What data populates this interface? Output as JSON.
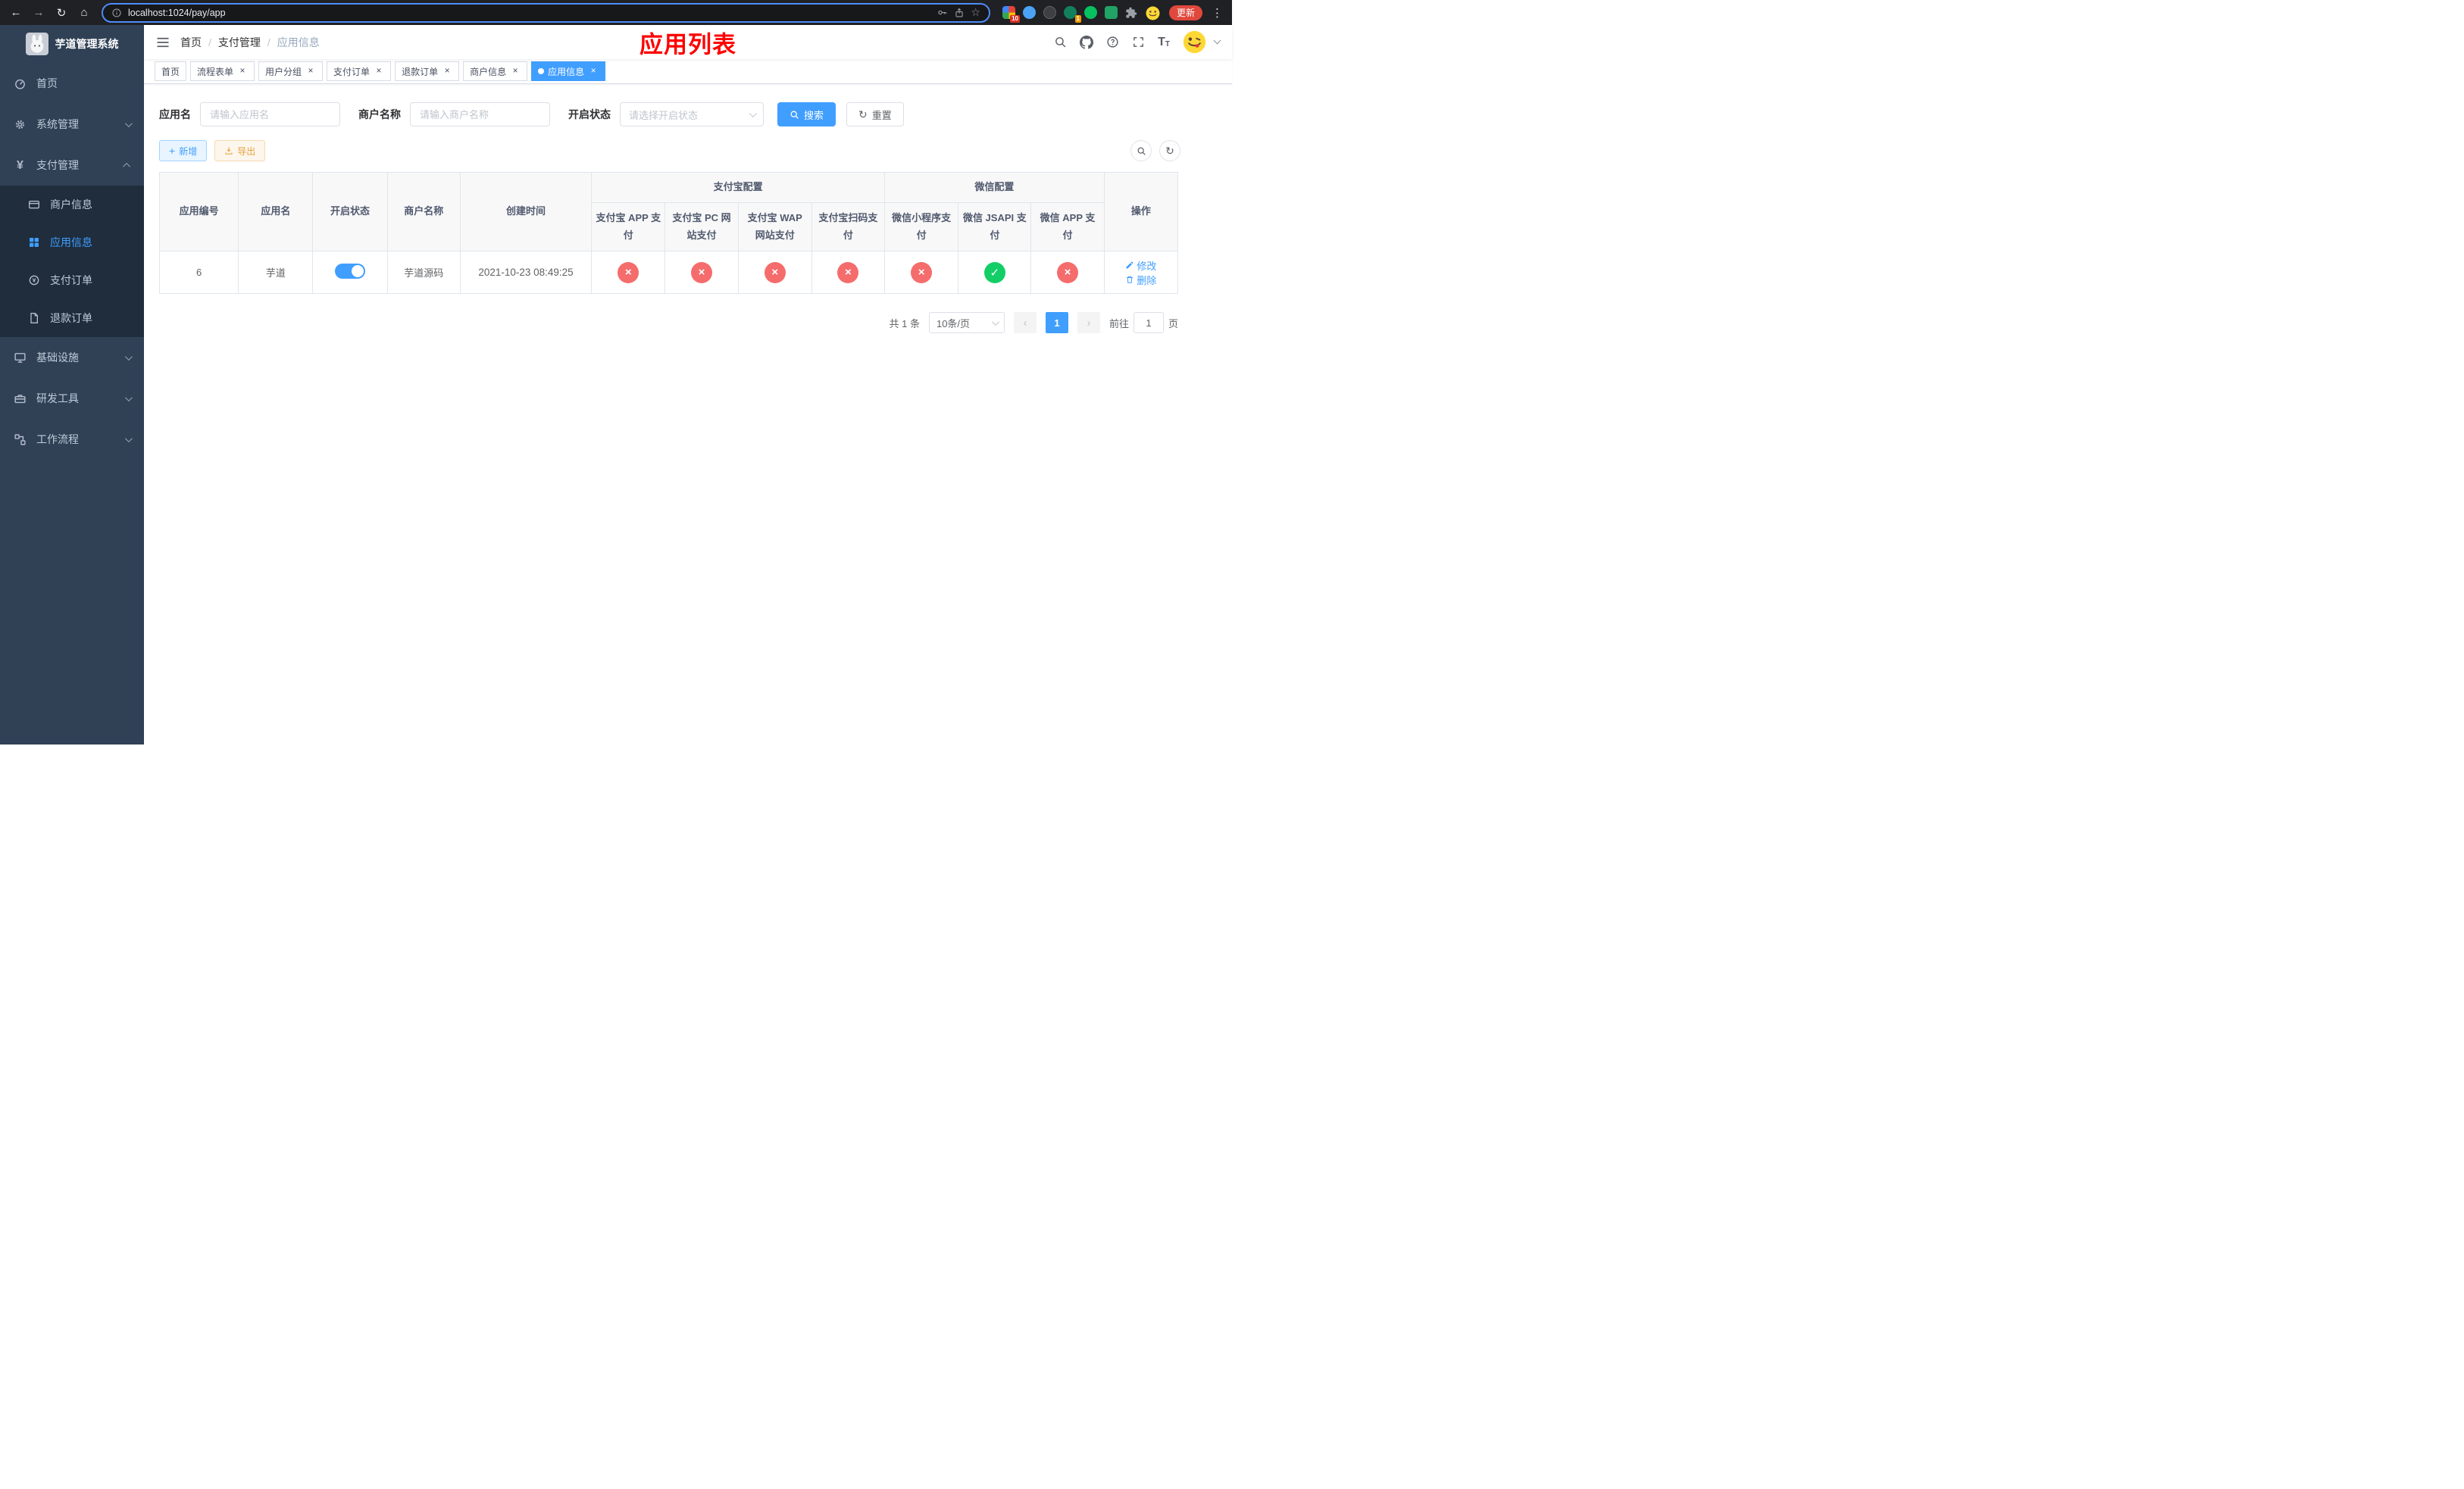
{
  "colors": {
    "primary": "#409eff",
    "success": "#13ce66",
    "danger": "#f56c6c",
    "warning": "#e6a23c",
    "annotation_red": "#ff0000",
    "sidebar_bg": "#304156",
    "submenu_bg": "#1f2d3d",
    "chrome_bg": "#202124"
  },
  "browser": {
    "url": "localhost:1024/pay/app",
    "update_button": "更新",
    "extension_badges": {
      "first": "10",
      "second": "1"
    }
  },
  "annotation": "应用列表",
  "sidebar": {
    "title": "芋道管理系统",
    "items": [
      {
        "label": "首页"
      },
      {
        "label": "系统管理"
      },
      {
        "label": "支付管理"
      },
      {
        "label": "商户信息"
      },
      {
        "label": "应用信息"
      },
      {
        "label": "支付订单"
      },
      {
        "label": "退款订单"
      },
      {
        "label": "基础设施"
      },
      {
        "label": "研发工具"
      },
      {
        "label": "工作流程"
      }
    ]
  },
  "breadcrumb": {
    "separator": "/",
    "items": [
      "首页",
      "支付管理",
      "应用信息"
    ]
  },
  "tabs": [
    {
      "label": "首页"
    },
    {
      "label": "流程表单"
    },
    {
      "label": "用户分组"
    },
    {
      "label": "支付订单"
    },
    {
      "label": "退款订单"
    },
    {
      "label": "商户信息"
    },
    {
      "label": "应用信息"
    }
  ],
  "filters": {
    "app_name_label": "应用名",
    "app_name_placeholder": "请输入应用名",
    "merchant_label": "商户名称",
    "merchant_placeholder": "请输入商户名称",
    "status_label": "开启状态",
    "status_placeholder": "请选择开启状态",
    "search_button": "搜索",
    "reset_button": "重置"
  },
  "toolbar": {
    "add_button": "新增",
    "export_button": "导出"
  },
  "table": {
    "group_headers": {
      "alipay": "支付宝配置",
      "wechat": "微信配置"
    },
    "columns": {
      "app_id": "应用编号",
      "app_name": "应用名",
      "status": "开启状态",
      "merchant": "商户名称",
      "created": "创建时间",
      "alipay_app": "支付宝 APP 支付",
      "alipay_pc": "支付宝 PC 网站支付",
      "alipay_wap": "支付宝 WAP 网站支付",
      "alipay_qr": "支付宝扫码支付",
      "wechat_mini": "微信小程序支付",
      "wechat_jsapi": "微信 JSAPI 支付",
      "wechat_app": "微信 APP 支付",
      "actions": "操作"
    },
    "row": {
      "app_id": "6",
      "app_name": "芋道",
      "status_on": true,
      "merchant": "芋道源码",
      "created": "2021-10-23 08:49:25",
      "alipay_app": "disabled",
      "alipay_pc": "disabled",
      "alipay_wap": "disabled",
      "alipay_qr": "disabled",
      "wechat_mini": "disabled",
      "wechat_jsapi": "enabled",
      "wechat_app": "disabled",
      "edit_button": "修改",
      "delete_button": "删除"
    }
  },
  "pagination": {
    "total": "共 1 条",
    "page_size": "10条/页",
    "page": "1",
    "goto_prefix": "前往",
    "goto_value": "1",
    "goto_suffix": "页"
  },
  "icons": {
    "back": "←",
    "forward": "→",
    "reload": "↻",
    "home": "⌂",
    "star": "☆",
    "more": "⋮",
    "close": "×",
    "check": "✓",
    "plus": "+",
    "yen": "¥",
    "prev": "‹",
    "next": "›"
  }
}
